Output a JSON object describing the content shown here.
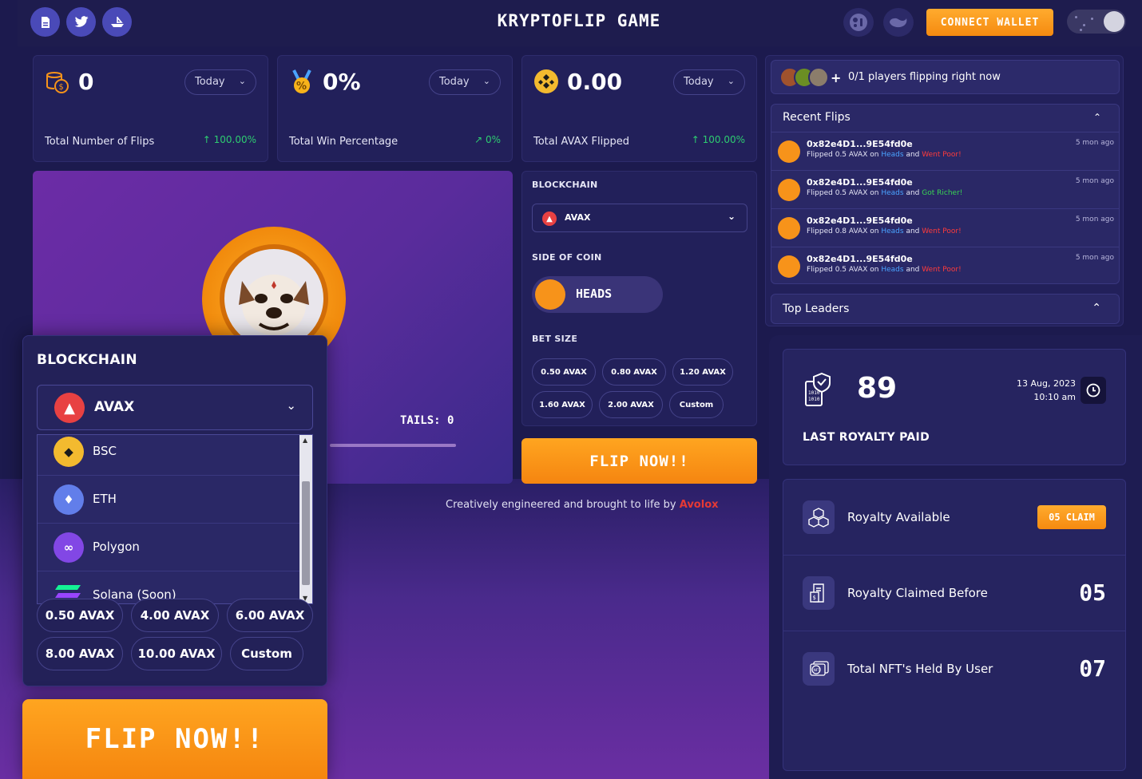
{
  "app": {
    "title": "KRYPTOFLIP GAME",
    "connect_label": "CONNECT WALLET"
  },
  "stats": [
    {
      "value": "0",
      "period": "Today",
      "label": "Total Number of Flips",
      "change": "100.00%"
    },
    {
      "value": "0%",
      "period": "Today",
      "label": "Total Win Percentage",
      "change": "0%"
    },
    {
      "value": "0.00",
      "period": "Today",
      "label": "Total AVAX Flipped",
      "change": "100.00%"
    }
  ],
  "hero": {
    "tails_label": "TAILS: 0"
  },
  "controls": {
    "blockchain_label": "BLOCKCHAIN",
    "blockchain_value": "AVAX",
    "side_label": "SIDE OF COIN",
    "side_value": "HEADS",
    "bet_label": "BET SIZE",
    "bets": [
      "0.50 AVAX",
      "0.80 AVAX",
      "1.20 AVAX",
      "1.60 AVAX",
      "2.00 AVAX",
      "Custom"
    ],
    "flip_label": "FLIP NOW!!"
  },
  "credit": {
    "text": "Creatively engineered and brought to life by",
    "brand": "Avolox"
  },
  "players": {
    "text": "0/1 players flipping right now"
  },
  "recent": {
    "title": "Recent Flips",
    "rows": [
      {
        "address": "0x82e4D1...9E54fd0e",
        "prefix": "Flipped 0.5 AVAX on",
        "side": "Heads",
        "and": "and",
        "result": "Went Poor!",
        "ago": "5 mon ago"
      },
      {
        "address": "0x82e4D1...9E54fd0e",
        "prefix": "Flipped 0.5 AVAX on",
        "side": "Heads",
        "and": "and",
        "result": "Got Richer!",
        "ago": "5 mon ago"
      },
      {
        "address": "0x82e4D1...9E54fd0e",
        "prefix": "Flipped 0.8 AVAX on",
        "side": "Heads",
        "and": "and",
        "result": "Went Poor!",
        "ago": "5 mon ago"
      },
      {
        "address": "0x82e4D1...9E54fd0e",
        "prefix": "Flipped 0.5 AVAX on",
        "side": "Heads",
        "and": "and",
        "result": "Went Poor!",
        "ago": "5 mon ago"
      }
    ]
  },
  "leaders": {
    "title": "Top Leaders"
  },
  "royalty": {
    "value": "89",
    "date": "13 Aug, 2023",
    "time": "10:10 am",
    "label": "LAST ROYALTY PAID",
    "rows": [
      {
        "label": "Royalty Available",
        "value": "05 CLAIM"
      },
      {
        "label": "Royalty Claimed Before",
        "value": "05"
      },
      {
        "label": "Total NFT's Held By User",
        "value": "07"
      }
    ]
  },
  "overlay": {
    "title": "BLOCKCHAIN",
    "selected": "AVAX",
    "options": [
      "BSC",
      "ETH",
      "Polygon",
      "Solana (Soon)"
    ],
    "bets": [
      "0.50 AVAX",
      "4.00 AVAX",
      "6.00 AVAX",
      "8.00 AVAX",
      "10.00 AVAX",
      "Custom"
    ],
    "flip_label": "FLIP NOW!!"
  },
  "colors": {
    "accent": "#f7931a",
    "avax": "#e84142",
    "positive": "#2ecc71",
    "link": "#4aa3ff",
    "negative": "#ff3b3b"
  },
  "icons": [
    "document-icon",
    "twitter-icon",
    "ship-icon",
    "game-icon",
    "whale-icon",
    "moon-icon",
    "coins-icon",
    "medal-icon",
    "bnb-icon",
    "avax-icon",
    "clock-icon",
    "nft-icon"
  ]
}
